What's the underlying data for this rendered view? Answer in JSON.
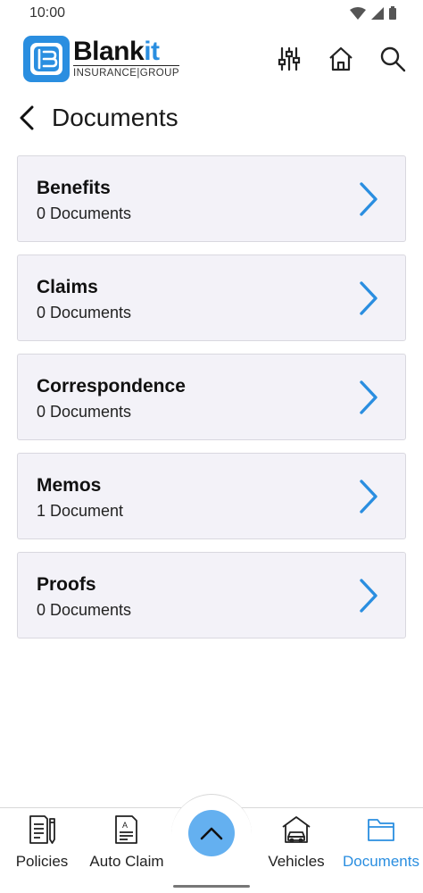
{
  "status_bar": {
    "time": "10:00"
  },
  "brand": {
    "name_main": "Blank",
    "name_accent": "it",
    "subtitle": "INSURANCE|GROUP",
    "accent_color": "#2a8ee0"
  },
  "header_icons": [
    "filter-sliders-icon",
    "home-icon",
    "search-icon"
  ],
  "page": {
    "title": "Documents"
  },
  "documents": [
    {
      "name": "Benefits",
      "count": "0 Documents"
    },
    {
      "name": "Claims",
      "count": "0 Documents"
    },
    {
      "name": "Correspondence",
      "count": "0 Documents"
    },
    {
      "name": "Memos",
      "count": "1 Document"
    },
    {
      "name": "Proofs",
      "count": "0 Documents"
    }
  ],
  "bottom_nav": {
    "items": [
      {
        "label": "Policies",
        "icon": "policy-document-icon"
      },
      {
        "label": "Auto Claim",
        "icon": "auto-claim-form-icon"
      },
      {
        "label": "Vehicles",
        "icon": "car-garage-icon"
      },
      {
        "label": "Documents",
        "icon": "folder-icon",
        "active": true
      }
    ],
    "fab_icon": "chevron-up-icon"
  }
}
